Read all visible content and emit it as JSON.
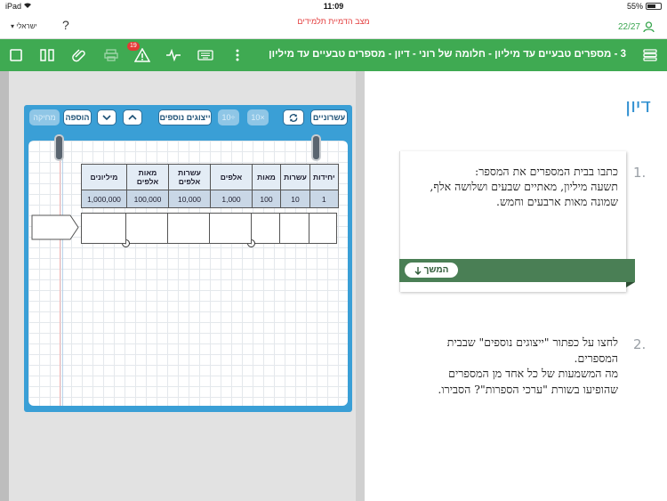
{
  "status_bar": {
    "device": "iPad",
    "time": "11:09",
    "battery": "55%",
    "battery_level": 0.55
  },
  "header": {
    "title": "מצב הדמיית תלמידים",
    "language": "ישראלי",
    "help": "?",
    "user_count": "22/27"
  },
  "toolbar": {
    "breadcrumb": "3 - מספרים טבעיים עד מיליון - חלומה של רוני - דיון - מספרים טבעיים עד מיליון",
    "alert_badge": "19"
  },
  "applet": {
    "buttons": {
      "decimals": "עשרוניים",
      "more_displays": "ייצוגים נוספים",
      "times10": "10×",
      "div10": "10÷",
      "up": "^",
      "down": "v",
      "add": "הוספה",
      "delete": "מחיקה"
    },
    "table": {
      "headers": [
        "יחידות",
        "עשרות",
        "מאות",
        "אלפים",
        "עשרות אלפים",
        "מאות אלפים",
        "מיליונים"
      ],
      "values": [
        "1",
        "10",
        "100",
        "1,000",
        "10,000",
        "100,000",
        "1,000,000"
      ]
    }
  },
  "discussion": {
    "heading": "דיון",
    "q1_number": "1.",
    "q1_line1": "כתבו בבית המספרים את המספר:",
    "q1_line2": "תשעה מיליון, מאתיים שבעים ושלושה אלף,",
    "q1_line3": "שמונה מאות ארבעים וחמש.",
    "continue_label": "המשך",
    "q2_number": "2.",
    "q2_line1": "לחצו על כפתור \"ייצוגים נוספים\" שבבית",
    "q2_line2": "המספרים.",
    "q2_line3": "מה המשמעות של כל אחד מן המספרים",
    "q2_line4": "שהופיעו בשורת \"ערכי הספרות\"? הסבירו."
  }
}
